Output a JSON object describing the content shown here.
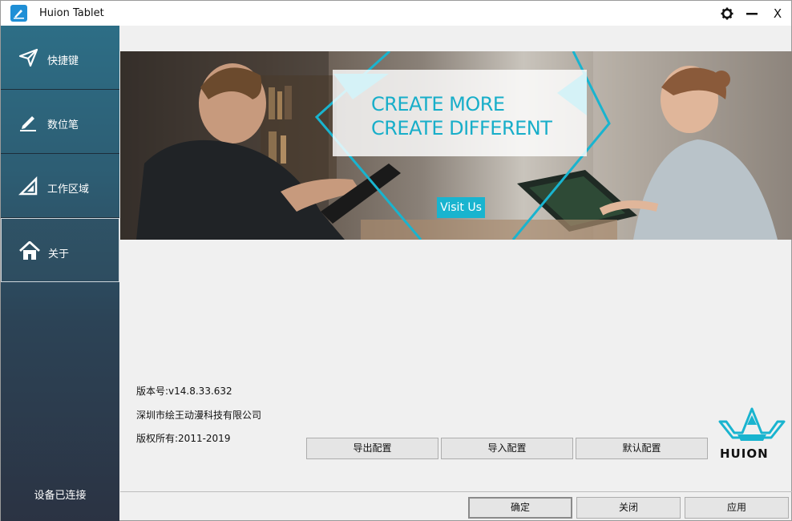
{
  "window": {
    "title": "Huion Tablet"
  },
  "titlebar_controls": {
    "settings_icon": "gear-icon",
    "minimize_icon": "minimize-icon",
    "close_label": "X"
  },
  "sidebar": {
    "items": [
      {
        "label": "快捷键",
        "icon": "send-icon",
        "active": false
      },
      {
        "label": "数位笔",
        "icon": "pen-icon",
        "active": false
      },
      {
        "label": "工作区域",
        "icon": "triangle-ruler-icon",
        "active": false
      },
      {
        "label": "关于",
        "icon": "home-icon",
        "active": true
      }
    ],
    "status": "设备已连接"
  },
  "banner": {
    "line1": "CREATE MORE",
    "line2": "CREATE DIFFERENT",
    "button": "Visit Us",
    "accent": "#19b4cf"
  },
  "about": {
    "version": "版本号:v14.8.33.632",
    "company": "深圳市绘王动漫科技有限公司",
    "copyright": "版权所有:2011-2019"
  },
  "config_buttons": {
    "export": "导出配置",
    "import": "导入配置",
    "default": "默认配置"
  },
  "footer_buttons": {
    "ok": "确定",
    "close": "关闭",
    "apply": "应用"
  },
  "logo": {
    "text": "HUION",
    "color": "#19b4cf"
  }
}
